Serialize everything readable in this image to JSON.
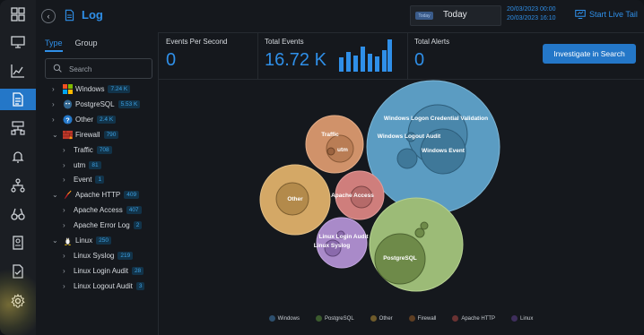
{
  "header": {
    "back_label": "‹",
    "title": "Log",
    "date_tag": "Today",
    "date_value": "Today",
    "date_from": "20/03/2023 00:00",
    "date_to": "20/03/2023 16:10",
    "live_tail": "Start Live Tail"
  },
  "panel": {
    "tabs": [
      "Type",
      "Group"
    ],
    "search_placeholder": "Search",
    "tree": [
      {
        "label": "Windows",
        "count": "7.24 K",
        "level": 0,
        "caret": "›",
        "icon": "windows-icon"
      },
      {
        "label": "PostgreSQL",
        "count": "5.53 K",
        "level": 0,
        "caret": "›",
        "icon": "postgresql-icon"
      },
      {
        "label": "Other",
        "count": "2.4 K",
        "level": 0,
        "caret": "›",
        "icon": "question-icon"
      },
      {
        "label": "Firewall",
        "count": "790",
        "level": 0,
        "caret": "⌄",
        "icon": "firewall-icon"
      },
      {
        "label": "Traffic",
        "count": "708",
        "level": 1,
        "caret": "›",
        "icon": ""
      },
      {
        "label": "utm",
        "count": "81",
        "level": 1,
        "caret": "›",
        "icon": ""
      },
      {
        "label": "Event",
        "count": "1",
        "level": 1,
        "caret": "›",
        "icon": ""
      },
      {
        "label": "Apache HTTP",
        "count": "409",
        "level": 0,
        "caret": "⌄",
        "icon": "apache-feather-icon"
      },
      {
        "label": "Apache Access",
        "count": "407",
        "level": 1,
        "caret": "›",
        "icon": ""
      },
      {
        "label": "Apache Error Log",
        "count": "2",
        "level": 1,
        "caret": "›",
        "icon": ""
      },
      {
        "label": "Linux",
        "count": "250",
        "level": 0,
        "caret": "⌄",
        "icon": "linux-icon"
      },
      {
        "label": "Linux Syslog",
        "count": "219",
        "level": 1,
        "caret": "›",
        "icon": ""
      },
      {
        "label": "Linux Login Audit",
        "count": "28",
        "level": 1,
        "caret": "›",
        "icon": ""
      },
      {
        "label": "Linux Logout Audit",
        "count": "3",
        "level": 1,
        "caret": "›",
        "icon": ""
      }
    ]
  },
  "metrics": {
    "eps_label": "Events Per Second",
    "eps_value": "0",
    "total_events_label": "Total Events",
    "total_events_value": "16.72 K",
    "total_alerts_label": "Total Alerts",
    "total_alerts_value": "0",
    "investigate_label": "Investigate in Search"
  },
  "bubbles": {
    "labels": {
      "windows_logon_cred": "Windows Logon Credential Validation",
      "windows_logout": "Windows Logout Audit",
      "windows_event": "Windows Event",
      "traffic": "Traffic",
      "utm": "utm",
      "other": "Other",
      "apache_access": "Apache Access",
      "linux_login": "Linux Login Audit",
      "linux_syslog": "Linux Syslog",
      "postgresql": "PostgreSQL"
    },
    "legend": [
      {
        "label": "Windows",
        "color": "#2d4f6e"
      },
      {
        "label": "PostgreSQL",
        "color": "#3b5a2e"
      },
      {
        "label": "Other",
        "color": "#6e5a2a"
      },
      {
        "label": "Firewall",
        "color": "#5e3e22"
      },
      {
        "label": "Apache HTTP",
        "color": "#6a3232"
      },
      {
        "label": "Linux",
        "color": "#3e2e5c"
      }
    ]
  }
}
